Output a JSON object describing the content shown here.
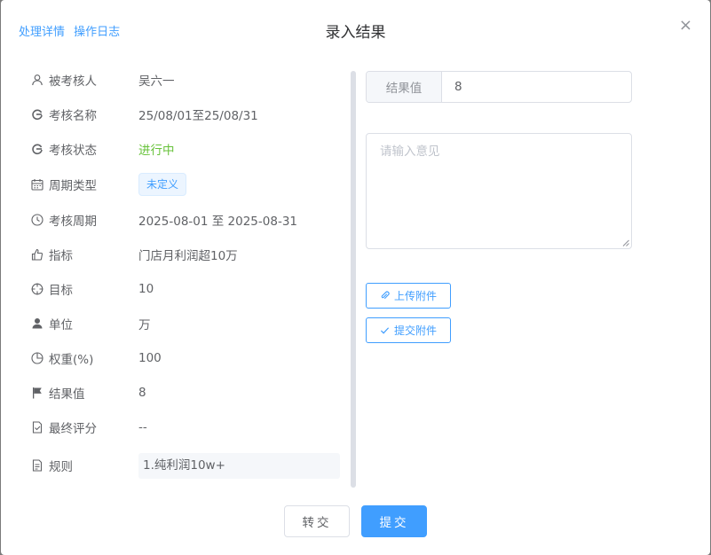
{
  "header": {
    "link_process": "处理详情",
    "link_log": "操作日志",
    "title": "录入结果",
    "close_glyph": "×"
  },
  "details": {
    "person": {
      "label": "被考核人",
      "value": "吴六一"
    },
    "name": {
      "label": "考核名称",
      "value": "25/08/01至25/08/31"
    },
    "status": {
      "label": "考核状态",
      "value": "进行中"
    },
    "cycle_type": {
      "label": "周期类型",
      "value": "未定义"
    },
    "period": {
      "label": "考核周期",
      "value": "2025-08-01 至 2025-08-31"
    },
    "indicator": {
      "label": "指标",
      "value": "门店月利润超10万"
    },
    "target": {
      "label": "目标",
      "value": "10"
    },
    "unit": {
      "label": "单位",
      "value": "万"
    },
    "weight": {
      "label": "权重(%)",
      "value": "100"
    },
    "result": {
      "label": "结果值",
      "value": "8"
    },
    "final_score": {
      "label": "最终评分",
      "value": "--"
    },
    "rule": {
      "label": "规则",
      "value": "1.纯利润10w+"
    }
  },
  "form": {
    "result_label": "结果值",
    "result_value": "8",
    "opinion_placeholder": "请输入意见",
    "upload_label": "上传附件",
    "submit_attachment_label": "提交附件"
  },
  "footer": {
    "transfer_label": "转交",
    "submit_label": "提交"
  },
  "colors": {
    "primary": "#409eff",
    "success": "#67c23a",
    "text": "#606266"
  }
}
